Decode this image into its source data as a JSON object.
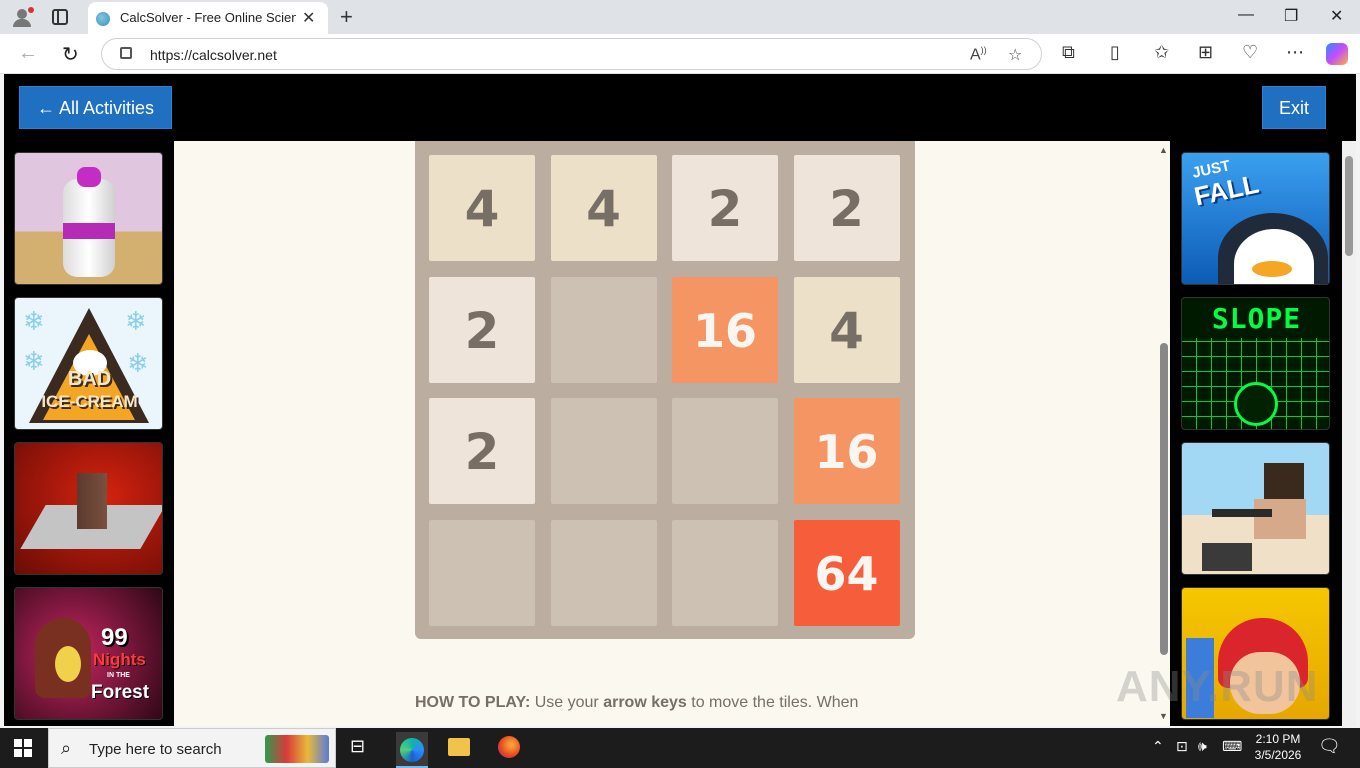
{
  "browser": {
    "tab_title": "CalcSolver - Free Online Scientific Calculator",
    "tab_close": "✕",
    "new_tab": "+",
    "url": "https://calcsolver.net",
    "window_controls": {
      "minimize": "—",
      "maximize": "❐",
      "close": "✕"
    },
    "nav": {
      "back": "←",
      "reload": "↻"
    },
    "toolbar_icons": [
      "read-aloud-icon",
      "favorite-star-icon",
      "extensions-icon",
      "split-screen-icon",
      "favorites-icon",
      "collections-icon",
      "browser-essentials-icon",
      "more-icon",
      "copilot-icon"
    ]
  },
  "page": {
    "back_button": "← All Activities",
    "exit_button": "Exit",
    "left_games": [
      {
        "name": "Bottle Flip",
        "colors": [
          "#e0c6de",
          "#d4b070"
        ]
      },
      {
        "name": "Bad Ice-Cream",
        "colors": [
          "#eaf6fb",
          "#5bb7d9"
        ]
      },
      {
        "name": "Cube game",
        "colors": [
          "#c21a0f",
          "#5a0a06"
        ]
      },
      {
        "name": "99 Nights in the Forest",
        "colors": [
          "#a81c48",
          "#3a0a1c"
        ]
      }
    ],
    "right_games": [
      {
        "name": "Just Fall",
        "colors": [
          "#2a8ee6",
          "#0d5bb5"
        ]
      },
      {
        "name": "Slope",
        "colors": [
          "#003300",
          "#00ff44"
        ]
      },
      {
        "name": "Shooter game",
        "colors": [
          "#a3d8f4",
          "#e7d4b5"
        ]
      },
      {
        "name": "Subway Surfers",
        "colors": [
          "#f6c700",
          "#d9252b"
        ]
      }
    ],
    "logo_texts": {
      "just_fall_1": "JUST",
      "just_fall_2": "FALL",
      "slope": "SLOPE",
      "bad_ice_cream_1": "BAD",
      "bad_ice_cream_2": "ICE-CREAM",
      "nights_1": "99",
      "nights_2": "Nights",
      "nights_3": "IN THE",
      "nights_4": "Forest"
    },
    "board": [
      [
        "4",
        "4",
        "2",
        "2"
      ],
      [
        "2",
        "",
        "16",
        "4"
      ],
      [
        "2",
        "",
        "",
        "16"
      ],
      [
        "",
        "",
        "",
        "64"
      ]
    ],
    "tile_colors": {
      "": {
        "bg": "#cdc1b4",
        "fg": "#776e65"
      },
      "2": {
        "bg": "#eee4da",
        "fg": "#776e65"
      },
      "4": {
        "bg": "#ede0c8",
        "fg": "#776e65"
      },
      "16": {
        "bg": "#f59563",
        "fg": "#f9f6f2"
      },
      "64": {
        "bg": "#f65e3b",
        "fg": "#f9f6f2"
      }
    },
    "howto_label": "HOW TO PLAY:",
    "howto_text1": " Use your ",
    "howto_bold": "arrow keys",
    "howto_text2": " to move the tiles. When"
  },
  "watermark": "ANY.RUN",
  "taskbar": {
    "search_placeholder": "Type here to search",
    "time": "2:10 PM",
    "date": "3/5/2026"
  }
}
